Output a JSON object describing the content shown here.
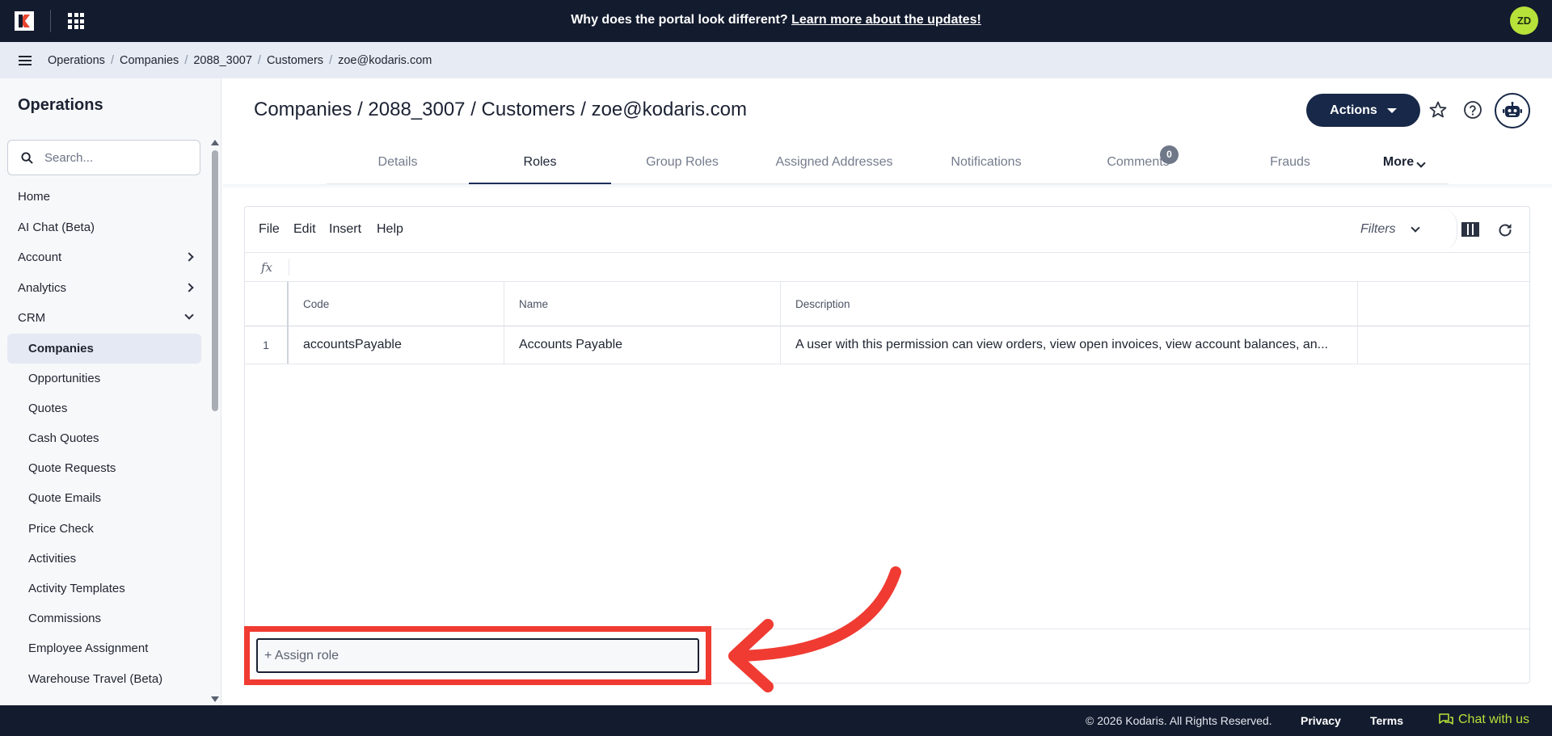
{
  "topbar": {
    "banner_text": "Why does the portal look different?",
    "banner_link": "Learn more about the updates!",
    "avatar_initials": "ZD",
    "brand_color": "#131b2e",
    "avatar_color": "#b7e23a"
  },
  "breadcrumb": [
    "Operations",
    "Companies",
    "2088_3007",
    "Customers",
    "zoe@kodaris.com"
  ],
  "sidebar": {
    "title": "Operations",
    "search_placeholder": "Search...",
    "items": [
      {
        "label": "Home",
        "type": "top"
      },
      {
        "label": "AI Chat (Beta)",
        "type": "top"
      },
      {
        "label": "Account",
        "type": "top",
        "chevron": "right"
      },
      {
        "label": "Analytics",
        "type": "top",
        "chevron": "right"
      },
      {
        "label": "CRM",
        "type": "top",
        "chevron": "down"
      },
      {
        "label": "Companies",
        "type": "sub",
        "active": true
      },
      {
        "label": "Opportunities",
        "type": "sub"
      },
      {
        "label": "Quotes",
        "type": "sub"
      },
      {
        "label": "Cash Quotes",
        "type": "sub"
      },
      {
        "label": "Quote Requests",
        "type": "sub"
      },
      {
        "label": "Quote Emails",
        "type": "sub"
      },
      {
        "label": "Price Check",
        "type": "sub"
      },
      {
        "label": "Activities",
        "type": "sub"
      },
      {
        "label": "Activity Templates",
        "type": "sub"
      },
      {
        "label": "Commissions",
        "type": "sub"
      },
      {
        "label": "Employee Assignment",
        "type": "sub"
      },
      {
        "label": "Warehouse Travel (Beta)",
        "type": "sub"
      }
    ]
  },
  "main": {
    "title": "Companies / 2088_3007 / Customers / zoe@kodaris.com",
    "actions_label": "Actions",
    "tabs": [
      {
        "label": "Details"
      },
      {
        "label": "Roles",
        "active": true
      },
      {
        "label": "Group Roles"
      },
      {
        "label": "Assigned Addresses"
      },
      {
        "label": "Notifications"
      },
      {
        "label": "Comments",
        "badge": "0"
      },
      {
        "label": "Frauds"
      },
      {
        "label": "More"
      }
    ]
  },
  "grid": {
    "menu": [
      "File",
      "Edit",
      "Insert",
      "Help"
    ],
    "filters_label": "Filters",
    "fx_label": "fx",
    "columns": [
      "Code",
      "Name",
      "Description"
    ],
    "rows": [
      {
        "num": "1",
        "code": "accountsPayable",
        "name": "Accounts Payable",
        "description": "A user with this permission can view orders, view open invoices, view account balances, an..."
      }
    ],
    "assign_placeholder": "+ Assign role"
  },
  "annotation": {
    "color": "#f03b32"
  },
  "footer": {
    "copyright": "© 2026 Kodaris. All Rights Reserved.",
    "privacy": "Privacy",
    "terms": "Terms",
    "chat": "Chat with us"
  }
}
